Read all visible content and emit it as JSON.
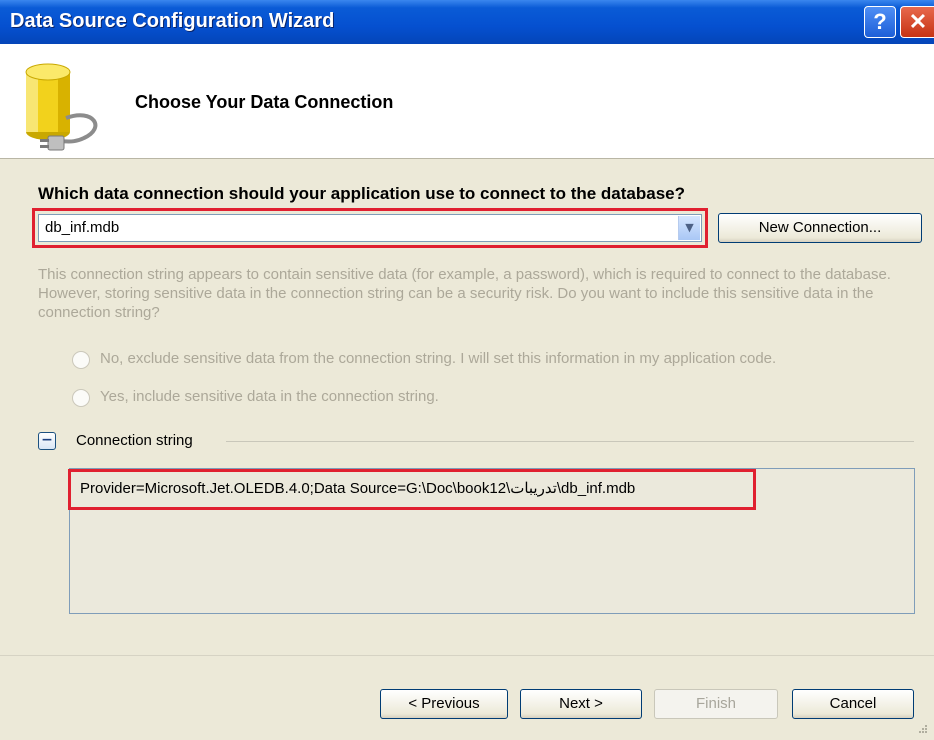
{
  "window": {
    "title": "Data Source Configuration Wizard",
    "help_label": "?",
    "close_label": "✕"
  },
  "header": {
    "title": "Choose Your Data Connection",
    "icon": "database-plug-icon"
  },
  "connection": {
    "question": "Which data connection should your application use to connect to the database?",
    "selected": "db_inf.mdb",
    "new_connection_label": "New Connection..."
  },
  "sensitive": {
    "description": "This connection string appears to contain sensitive data (for example, a password), which is required to connect to the database. However, storing sensitive data in the connection string can be a security risk. Do you want to include this sensitive data in the connection string?",
    "option_exclude": "No, exclude sensitive data from the connection string. I will set this information in my application code.",
    "option_include": "Yes, include sensitive data in the connection string."
  },
  "connection_string": {
    "toggle": "−",
    "label": "Connection string",
    "value": "Provider=Microsoft.Jet.OLEDB.4.0;Data Source=G:\\Doc\\book12\\تدريبات\\db_inf.mdb"
  },
  "footer": {
    "previous": "< Previous",
    "next": "Next >",
    "finish": "Finish",
    "cancel": "Cancel"
  },
  "colors": {
    "titlebar": "#0550d0",
    "highlight": "#e02030",
    "disabled_text": "#aca899"
  }
}
